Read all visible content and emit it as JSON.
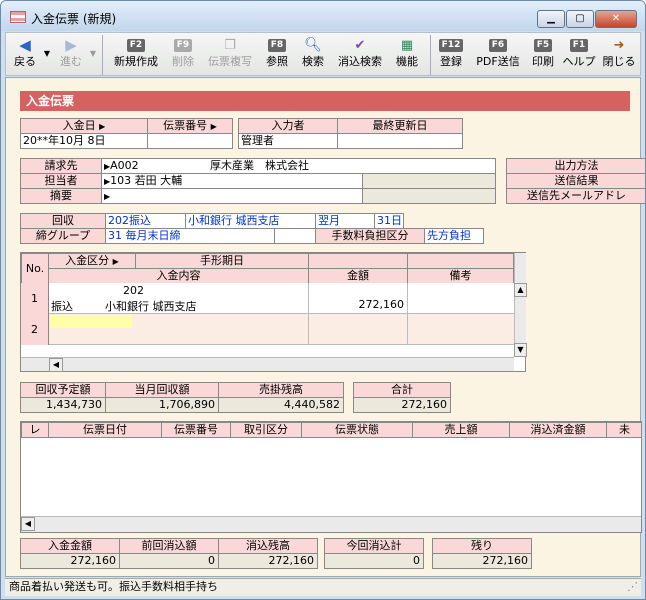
{
  "window": {
    "title": "入金伝票 (新規)"
  },
  "toolbar": {
    "back": "戻る",
    "forward": "進む",
    "f2": "F2",
    "new": "新規作成",
    "f9": "F9",
    "delete": "削除",
    "copy": "伝票複写",
    "f8": "F8",
    "ref": "参照",
    "search": "検索",
    "reconcile_search": "消込検索",
    "function": "機能",
    "f12": "F12",
    "register": "登録",
    "f6": "F6",
    "pdf": "PDF送信",
    "f5": "F5",
    "print": "印刷",
    "f1": "F1",
    "help": "ヘルプ",
    "close": "閉じる"
  },
  "section_title": "入金伝票",
  "header": {
    "date_label": "入金日",
    "slip_no_label": "伝票番号",
    "input_user_label": "入力者",
    "updated_label": "最終更新日",
    "date_value": "20**年10月 8日",
    "slip_no_value": "",
    "input_user_value": "管理者",
    "updated_value": ""
  },
  "billing": {
    "customer_label": "請求先",
    "customer_code": "A002",
    "customer_name": "厚木産業　株式会社",
    "staff_label": "担当者",
    "staff_code": "103",
    "staff_name": "若田 大輔",
    "summary_label": "摘要",
    "output_method": "出力方法",
    "send_result": "送信結果",
    "send_email": "送信先メールアドレ"
  },
  "collection": {
    "label": "回収",
    "method_code": "202",
    "method_name": "振込",
    "bank": "小和銀行 城西支店",
    "month": "翌月",
    "day_num": "31",
    "day_unit": "日",
    "group_label": "締グループ",
    "group_code": "31",
    "group_name": "毎月末日締",
    "fee_label": "手数料負担区分",
    "fee_value": "先方負担"
  },
  "grid": {
    "col_no": "No.",
    "col_type": "入金区分",
    "col_due": "手形期日",
    "col_content": "入金内容",
    "col_amount": "金額",
    "col_memo": "備考",
    "rows": [
      {
        "no": "1",
        "code": "202",
        "type": "振込",
        "content": "小和銀行 城西支店",
        "amount": "272,160"
      },
      {
        "no": "2",
        "code": "",
        "type": "",
        "content": "",
        "amount": ""
      }
    ]
  },
  "totals": {
    "planned_label": "回収予定額",
    "planned": "1,434,730",
    "month_label": "当月回収額",
    "month": "1,706,890",
    "balance_label": "売掛残高",
    "balance": "4,440,582",
    "total_label": "合計",
    "total": "272,160"
  },
  "recon": {
    "cols": [
      "レ",
      "伝票日付",
      "伝票番号",
      "取引区分",
      "伝票状態",
      "売上額",
      "消込済金額",
      "未"
    ]
  },
  "footer": {
    "deposit_label": "入金金額",
    "deposit": "272,160",
    "prev_label": "前回消込額",
    "prev": "0",
    "remain_label": "消込残高",
    "remain": "272,160",
    "now_label": "今回消込計",
    "now": "0",
    "rest_label": "残り",
    "rest": "272,160"
  },
  "statusbar": {
    "text": "商品着払い発送も可。振込手数料相手持ち"
  }
}
